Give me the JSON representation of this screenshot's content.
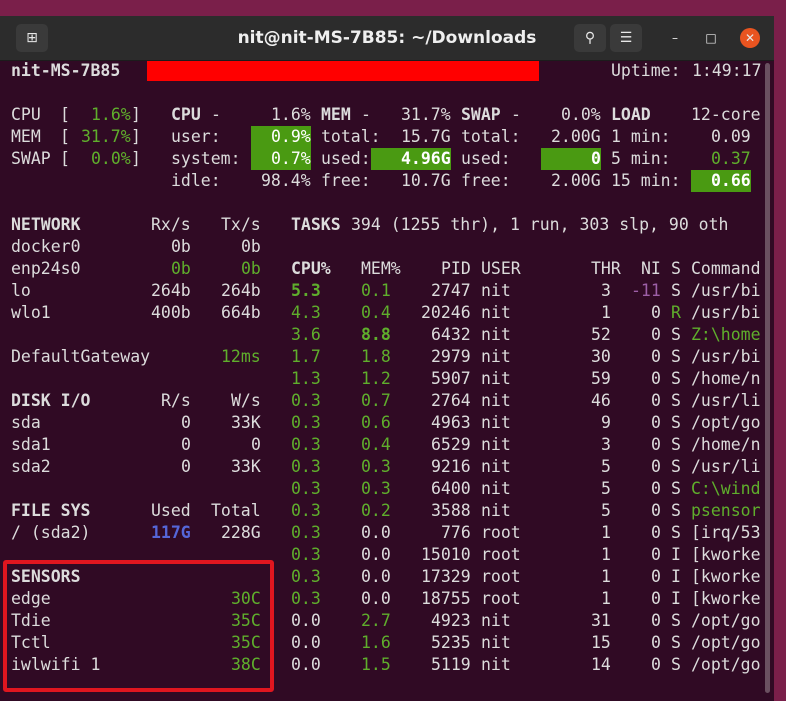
{
  "window": {
    "title": "nit@nit-MS-7B85: ~/Downloads",
    "new_tab_icon": "⊞",
    "search_icon": "⚲",
    "menu_icon": "☰",
    "minimize_icon": "–",
    "maximize_icon": "□",
    "close_icon": "✕",
    "close_color": "#e95420"
  },
  "header": {
    "hostname": "nit-MS-7B85",
    "uptime_label": "Uptime:",
    "uptime": "1:49:17"
  },
  "meters": {
    "cpu": {
      "label": "CPU",
      "open": "[",
      "value": "1.6%",
      "close": "]",
      "fill_percent": 1.6
    },
    "mem": {
      "label": "MEM",
      "open": "[",
      "value": "31.7%",
      "close": "]",
      "fill_percent": 31.7
    },
    "swap": {
      "label": "SWAP",
      "open": "[",
      "value": "0.0%",
      "close": "]",
      "fill_percent": 0.0
    }
  },
  "cpu_panel": {
    "title": "CPU",
    "dash": "-",
    "total": "1.6%",
    "user_label": "user:",
    "user": "0.9%",
    "system_label": "system:",
    "system": "0.7%",
    "idle_label": "idle:",
    "idle": "98.4%"
  },
  "mem_panel": {
    "title": "MEM",
    "dash": "-",
    "percent": "31.7%",
    "total_label": "total:",
    "total": "15.7G",
    "used_label": "used:",
    "used": "4.96G",
    "free_label": "free:",
    "free": "10.7G"
  },
  "swap_panel": {
    "title": "SWAP",
    "dash": "-",
    "percent": "0.0%",
    "total_label": "total:",
    "total": "2.00G",
    "used_label": "used:",
    "used": "0",
    "free_label": "free:",
    "free": "2.00G"
  },
  "load_panel": {
    "title": "LOAD",
    "cores": "12-core",
    "m1_label": "1 min:",
    "m1": "0.09",
    "m5_label": "5 min:",
    "m5": "0.37",
    "m15_label": "15 min:",
    "m15": "0.66"
  },
  "network": {
    "title": "NETWORK",
    "rx_header": "Rx/s",
    "tx_header": "Tx/s",
    "rows": [
      {
        "name": "docker0",
        "rx": "0b",
        "tx": "0b"
      },
      {
        "name": "enp24s0",
        "rx": "0b",
        "tx": "0b"
      },
      {
        "name": "lo",
        "rx": "264b",
        "tx": "264b"
      },
      {
        "name": "wlo1",
        "rx": "400b",
        "tx": "664b"
      }
    ],
    "gateway_label": "DefaultGateway",
    "gateway_value": "12ms"
  },
  "disk": {
    "title": "DISK I/O",
    "r_header": "R/s",
    "w_header": "W/s",
    "rows": [
      {
        "name": "sda",
        "r": "0",
        "w": "33K"
      },
      {
        "name": "sda1",
        "r": "0",
        "w": "0"
      },
      {
        "name": "sda2",
        "r": "0",
        "w": "33K"
      }
    ]
  },
  "filesys": {
    "title": "FILE SYS",
    "used_header": "Used",
    "total_header": "Total",
    "mount": "/ (sda2)",
    "used": "117G",
    "total": "228G"
  },
  "sensors": {
    "title": "SENSORS",
    "rows": [
      {
        "name": "edge",
        "value": "30C"
      },
      {
        "name": "Tdie",
        "value": "35C"
      },
      {
        "name": "Tctl",
        "value": "35C"
      },
      {
        "name": "iwlwifi 1",
        "value": "38C"
      }
    ]
  },
  "tasks": {
    "label": "TASKS",
    "summary": "394 (1255 thr), 1 run, 303 slp, 90 oth"
  },
  "process_table": {
    "headers": {
      "cpu": "CPU%",
      "mem": "MEM%",
      "pid": "PID",
      "user": "USER",
      "thr": "THR",
      "ni": "NI",
      "s": "S",
      "command": "Command"
    },
    "rows": [
      {
        "cpu": "5.3",
        "mem": "0.1",
        "pid": "2747",
        "user": "nit",
        "thr": "3",
        "ni": "-11",
        "s": "S",
        "cmd": "/usr/bi"
      },
      {
        "cpu": "4.3",
        "mem": "0.4",
        "pid": "20246",
        "user": "nit",
        "thr": "1",
        "ni": "0",
        "s": "R",
        "cmd": "/usr/bi"
      },
      {
        "cpu": "3.6",
        "mem": "8.8",
        "pid": "6432",
        "user": "nit",
        "thr": "52",
        "ni": "0",
        "s": "S",
        "cmd": "Z:\\home"
      },
      {
        "cpu": "1.7",
        "mem": "1.8",
        "pid": "2979",
        "user": "nit",
        "thr": "30",
        "ni": "0",
        "s": "S",
        "cmd": "/usr/bi"
      },
      {
        "cpu": "1.3",
        "mem": "1.2",
        "pid": "5907",
        "user": "nit",
        "thr": "59",
        "ni": "0",
        "s": "S",
        "cmd": "/home/n"
      },
      {
        "cpu": "0.3",
        "mem": "0.7",
        "pid": "2764",
        "user": "nit",
        "thr": "46",
        "ni": "0",
        "s": "S",
        "cmd": "/usr/li"
      },
      {
        "cpu": "0.3",
        "mem": "0.6",
        "pid": "4963",
        "user": "nit",
        "thr": "9",
        "ni": "0",
        "s": "S",
        "cmd": "/opt/go"
      },
      {
        "cpu": "0.3",
        "mem": "0.4",
        "pid": "6529",
        "user": "nit",
        "thr": "3",
        "ni": "0",
        "s": "S",
        "cmd": "/home/n"
      },
      {
        "cpu": "0.3",
        "mem": "0.3",
        "pid": "9216",
        "user": "nit",
        "thr": "5",
        "ni": "0",
        "s": "S",
        "cmd": "/usr/li"
      },
      {
        "cpu": "0.3",
        "mem": "0.3",
        "pid": "6400",
        "user": "nit",
        "thr": "5",
        "ni": "0",
        "s": "S",
        "cmd": "C:\\wind"
      },
      {
        "cpu": "0.3",
        "mem": "0.2",
        "pid": "3588",
        "user": "nit",
        "thr": "5",
        "ni": "0",
        "s": "S",
        "cmd": "psensor"
      },
      {
        "cpu": "0.3",
        "mem": "0.0",
        "pid": "776",
        "user": "root",
        "thr": "1",
        "ni": "0",
        "s": "S",
        "cmd": "[irq/53"
      },
      {
        "cpu": "0.3",
        "mem": "0.0",
        "pid": "15010",
        "user": "root",
        "thr": "1",
        "ni": "0",
        "s": "I",
        "cmd": "[kworke"
      },
      {
        "cpu": "0.3",
        "mem": "0.0",
        "pid": "17329",
        "user": "root",
        "thr": "1",
        "ni": "0",
        "s": "I",
        "cmd": "[kworke"
      },
      {
        "cpu": "0.3",
        "mem": "0.0",
        "pid": "18755",
        "user": "root",
        "thr": "1",
        "ni": "0",
        "s": "I",
        "cmd": "[kworke"
      },
      {
        "cpu": "0.0",
        "mem": "2.7",
        "pid": "4923",
        "user": "nit",
        "thr": "31",
        "ni": "0",
        "s": "S",
        "cmd": "/opt/go"
      },
      {
        "cpu": "0.0",
        "mem": "1.6",
        "pid": "5235",
        "user": "nit",
        "thr": "15",
        "ni": "0",
        "s": "S",
        "cmd": "/opt/go"
      },
      {
        "cpu": "0.0",
        "mem": "1.5",
        "pid": "5119",
        "user": "nit",
        "thr": "14",
        "ni": "0",
        "s": "S",
        "cmd": "/opt/go"
      }
    ]
  },
  "colors": {
    "terminal_bg": "#300a24",
    "green": "#5fae2c",
    "bar_green": "#4a9a12",
    "purple": "#9d5fa7",
    "blue": "#5566d8",
    "highlight_red": "#e0161f"
  }
}
